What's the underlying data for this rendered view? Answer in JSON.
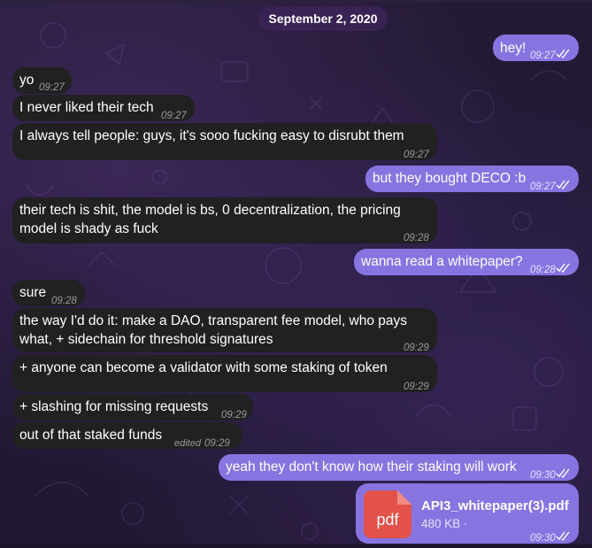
{
  "date_label": "September 2, 2020",
  "messages": [
    {
      "text": "hey!",
      "time": "09:27"
    },
    {
      "text": "yo",
      "time": "09:27"
    },
    {
      "text": "I never liked their tech",
      "time": "09:27"
    },
    {
      "text": "I always tell people: guys, it's sooo fucking easy to disrubt them",
      "time": "09:27"
    },
    {
      "text": "but they bought DECO :b",
      "time": "09:27"
    },
    {
      "line1": "their tech is shit, the model is bs, 0 decentralization, the pricing",
      "line2": "model is shady as fuck",
      "time": "09:28"
    },
    {
      "text": "wanna read a whitepaper?",
      "time": "09:28"
    },
    {
      "text": "sure",
      "time": "09:28"
    },
    {
      "line1": "the way I'd do it: make a DAO, transparent fee model, who pays",
      "line2": "what,  + sidechain for threshold signatures",
      "time": "09:29"
    },
    {
      "text": "+ anyone can become a validator with some staking of token",
      "time": "09:29"
    },
    {
      "text": "+ slashing for missing requests",
      "time": "09:29"
    },
    {
      "text": "out of that staked funds",
      "edited": "edited",
      "time": "09:29"
    },
    {
      "text": "yeah they don't know how their staking will work",
      "time": "09:30"
    }
  ],
  "file": {
    "icon_label": "pdf",
    "name": "API3_whitepaper(3).pdf",
    "size": "480 KB ·",
    "time": "09:30"
  },
  "colors": {
    "outgoing_bubble": "#8774e1",
    "incoming_bubble": "#212121",
    "date_pill": "#3a2456",
    "pdf_icon": "#e2524a"
  },
  "icons": {
    "read_receipt": "double-check-icon",
    "file_type": "pdf-file-icon"
  }
}
